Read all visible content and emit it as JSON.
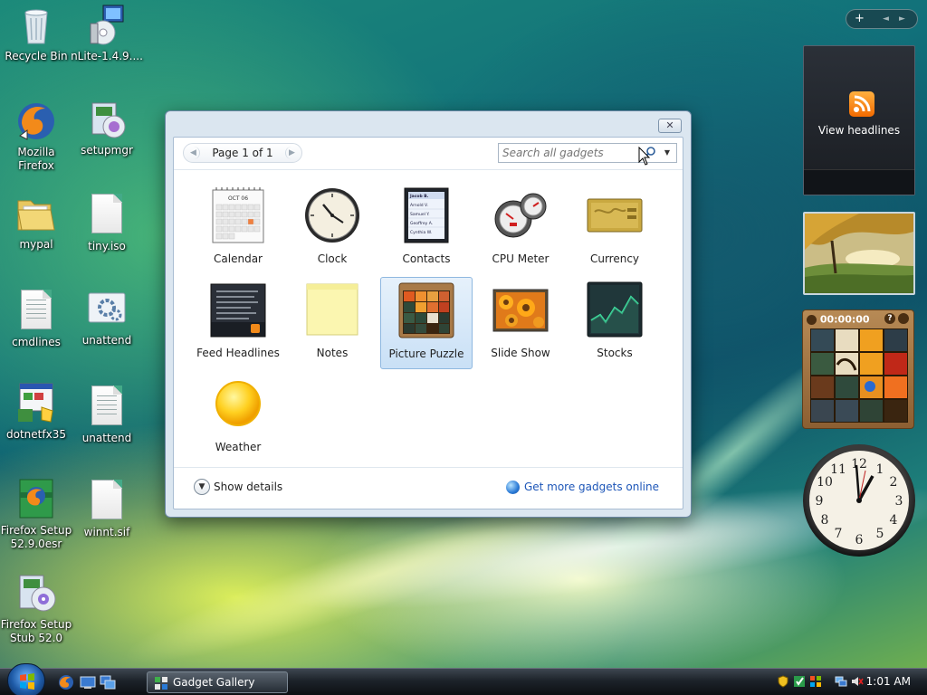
{
  "desktop": {
    "icons": [
      {
        "label": "Recycle Bin"
      },
      {
        "label": "nLite-1.4.9...."
      },
      {
        "label": "Mozilla Firefox"
      },
      {
        "label": "setupmgr"
      },
      {
        "label": "mypal"
      },
      {
        "label": "tiny.iso"
      },
      {
        "label": "cmdlines"
      },
      {
        "label": "unattend"
      },
      {
        "label": "dotnetfx35"
      },
      {
        "label": "unattend"
      },
      {
        "label": "Firefox Setup 52.9.0esr"
      },
      {
        "label": "winnt.sif"
      },
      {
        "label": "Firefox Setup Stub 52.0"
      }
    ]
  },
  "gallery": {
    "close_label": "✕",
    "pager_label": "Page 1 of 1",
    "search_placeholder": "Search all gadgets",
    "gadgets": [
      {
        "name": "Calendar",
        "month": "OCT 06"
      },
      {
        "name": "Clock"
      },
      {
        "name": "Contacts",
        "entries": [
          "Jacob B.",
          "Arnold V.",
          "Samuel Y.",
          "Geoffrey A.",
          "Cynthia W."
        ]
      },
      {
        "name": "CPU Meter"
      },
      {
        "name": "Currency"
      },
      {
        "name": "Feed Headlines"
      },
      {
        "name": "Notes"
      },
      {
        "name": "Picture Puzzle",
        "selected": true
      },
      {
        "name": "Slide Show"
      },
      {
        "name": "Stocks"
      },
      {
        "name": "Weather"
      }
    ],
    "show_details_label": "Show details",
    "get_more_label": "Get more gadgets online"
  },
  "sidebar": {
    "controls": {
      "add": "+",
      "prev": "◄",
      "next": "►"
    },
    "feed_label": "View headlines",
    "puzzle_timer": "00:00:00",
    "puzzle_help": "?"
  },
  "taskbar": {
    "task_label": "Gadget Gallery",
    "time": "1:01 AM"
  },
  "colors": {
    "link": "#1d56b8",
    "rss_orange": "#f26a00",
    "selection": "#c9e0f6"
  }
}
